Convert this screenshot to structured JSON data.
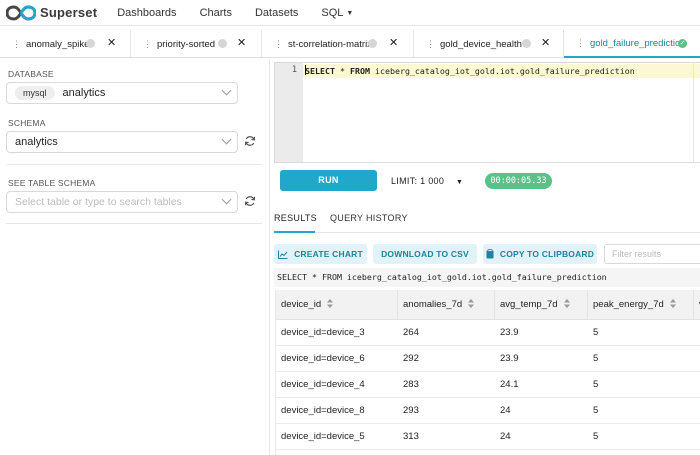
{
  "app": {
    "brand": "Superset",
    "brand_colors": {
      "left_loop": "#484848",
      "right_loop": "#20a7c9",
      "accent": "#20a7c9",
      "success": "#5ac189"
    }
  },
  "nav": {
    "items": [
      "Dashboards",
      "Charts",
      "Datasets",
      "SQL"
    ]
  },
  "tabs": [
    {
      "label": "anomaly_spikes",
      "status": "idle",
      "active": false
    },
    {
      "label": "priority-sorted",
      "status": "idle",
      "active": false
    },
    {
      "label": "st-correlation-matrix",
      "status": "idle",
      "active": false
    },
    {
      "label": "gold_device_health",
      "status": "idle",
      "active": false
    },
    {
      "label": "gold_failure_prediction",
      "status": "success",
      "active": true
    }
  ],
  "left": {
    "database_label": "DATABASE",
    "database_type": "mysql",
    "database_value": "analytics",
    "schema_label": "SCHEMA",
    "schema_value": "analytics",
    "table_schema_label": "SEE TABLE SCHEMA",
    "table_placeholder": "Select table or type to search tables"
  },
  "editor": {
    "line_number": "1",
    "keyword_select": "SELECT",
    "star": "*",
    "keyword_from": "FROM",
    "table_ref": "iceberg_catalog_iot_gold.iot.gold_failure_prediction"
  },
  "run": {
    "run_label": "RUN",
    "limit_label": "LIMIT:",
    "limit_value": "1 000",
    "timer": "00:00:05.33"
  },
  "results": {
    "tab_results": "RESULTS",
    "tab_history": "QUERY HISTORY",
    "create_chart": "CREATE CHART",
    "download_csv": "DOWNLOAD TO CSV",
    "copy_clipboard": "COPY TO CLIPBOARD",
    "filter_placeholder": "Filter results",
    "sql_echo": "SELECT * FROM iceberg_catalog_iot_gold.iot.gold_failure_prediction",
    "columns": [
      "device_id",
      "anomalies_7d",
      "avg_temp_7d",
      "peak_energy_7d",
      "v"
    ],
    "rows": [
      [
        "device_id=device_3",
        "264",
        "23.9",
        "5"
      ],
      [
        "device_id=device_6",
        "292",
        "23.9",
        "5"
      ],
      [
        "device_id=device_4",
        "283",
        "24.1",
        "5"
      ],
      [
        "device_id=device_8",
        "293",
        "24",
        "5"
      ],
      [
        "device_id=device_5",
        "313",
        "24",
        "5"
      ]
    ]
  }
}
